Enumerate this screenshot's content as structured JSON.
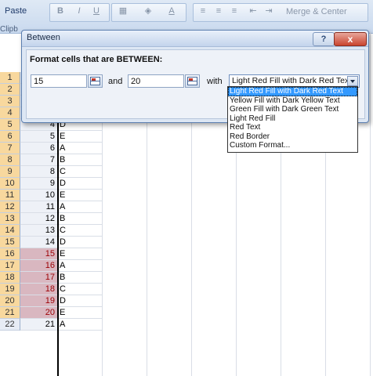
{
  "ribbon": {
    "paste_label": "Paste",
    "clipboard_label": "Clipb",
    "merge_label": "Merge & Center"
  },
  "rows": [
    {
      "num": "1",
      "a": "",
      "b": "",
      "hl": false
    },
    {
      "num": "2",
      "a": "",
      "b": "",
      "hl": false
    },
    {
      "num": "3",
      "a": "",
      "b": "",
      "hl": false
    },
    {
      "num": "4",
      "a": "",
      "b": "",
      "hl": false
    },
    {
      "num": "5",
      "a": "4",
      "b": "D",
      "hl": false
    },
    {
      "num": "6",
      "a": "5",
      "b": "E",
      "hl": false
    },
    {
      "num": "7",
      "a": "6",
      "b": "A",
      "hl": false
    },
    {
      "num": "8",
      "a": "7",
      "b": "B",
      "hl": false
    },
    {
      "num": "9",
      "a": "8",
      "b": "C",
      "hl": false
    },
    {
      "num": "10",
      "a": "9",
      "b": "D",
      "hl": false
    },
    {
      "num": "11",
      "a": "10",
      "b": "E",
      "hl": false
    },
    {
      "num": "12",
      "a": "11",
      "b": "A",
      "hl": false
    },
    {
      "num": "13",
      "a": "12",
      "b": "B",
      "hl": false
    },
    {
      "num": "14",
      "a": "13",
      "b": "C",
      "hl": false
    },
    {
      "num": "15",
      "a": "14",
      "b": "D",
      "hl": false
    },
    {
      "num": "16",
      "a": "15",
      "b": "E",
      "hl": true
    },
    {
      "num": "17",
      "a": "16",
      "b": "A",
      "hl": true
    },
    {
      "num": "18",
      "a": "17",
      "b": "B",
      "hl": true
    },
    {
      "num": "19",
      "a": "18",
      "b": "C",
      "hl": true
    },
    {
      "num": "20",
      "a": "19",
      "b": "D",
      "hl": true
    },
    {
      "num": "21",
      "a": "20",
      "b": "E",
      "hl": true
    },
    {
      "num": "22",
      "a": "21",
      "b": "A",
      "hl": false
    }
  ],
  "dialog": {
    "title": "Between",
    "help_label": "?",
    "close_label": "x",
    "heading": "Format cells that are BETWEEN:",
    "low_value": "15",
    "and_label": "and",
    "high_value": "20",
    "with_label": "with",
    "selected_format": "Light Red Fill with Dark Red Text",
    "options": [
      "Light Red Fill with Dark Red Text",
      "Yellow Fill with Dark Yellow Text",
      "Green Fill with Dark Green Text",
      "Light Red Fill",
      "Red Text",
      "Red Border",
      "Custom Format..."
    ]
  },
  "colors": {
    "highlight_fill": "#d9b7c0",
    "highlight_text": "#9c0006",
    "selected_option": "#3399ff"
  }
}
